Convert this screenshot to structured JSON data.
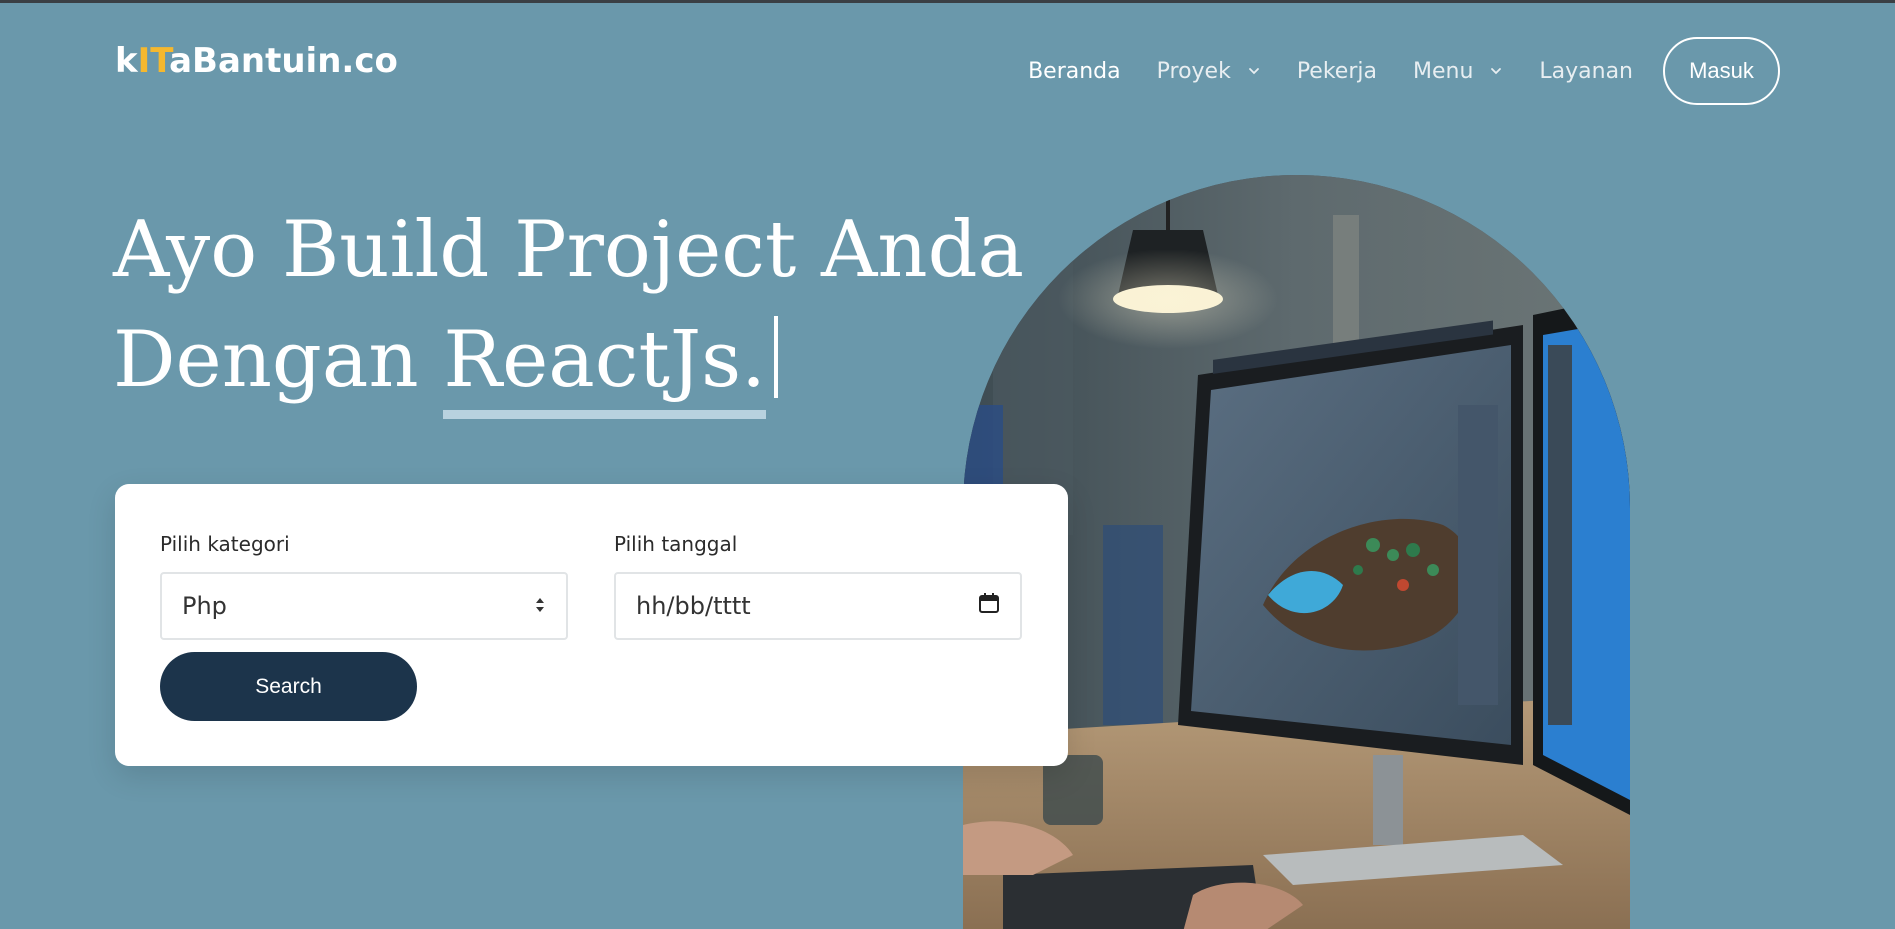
{
  "brand": {
    "part1": "k",
    "part2": "IT",
    "part3": "aBantuin.co"
  },
  "nav": {
    "items": [
      {
        "label": "Beranda",
        "active": true,
        "dropdown": false
      },
      {
        "label": "Proyek",
        "active": false,
        "dropdown": true
      },
      {
        "label": "Pekerja",
        "active": false,
        "dropdown": false
      },
      {
        "label": "Menu",
        "active": false,
        "dropdown": true
      },
      {
        "label": "Layanan",
        "active": false,
        "dropdown": false
      }
    ],
    "login_label": "Masuk"
  },
  "hero": {
    "line1": "Ayo Build Project Anda",
    "line2_prefix": "Dengan ",
    "line2_highlight": "ReactJs."
  },
  "search": {
    "category_label": "Pilih kategori",
    "category_value": "Php",
    "date_label": "Pilih tanggal",
    "date_value": "hh/bb/tttt",
    "button_label": "Search"
  },
  "icons": {
    "dropdown": "chevron-down-icon",
    "select": "sort-arrows-icon",
    "date": "calendar-icon"
  },
  "colors": {
    "background": "#6a98ab",
    "accent": "#f5b82e",
    "button": "#1c344b",
    "underline": "#b8d2df"
  }
}
